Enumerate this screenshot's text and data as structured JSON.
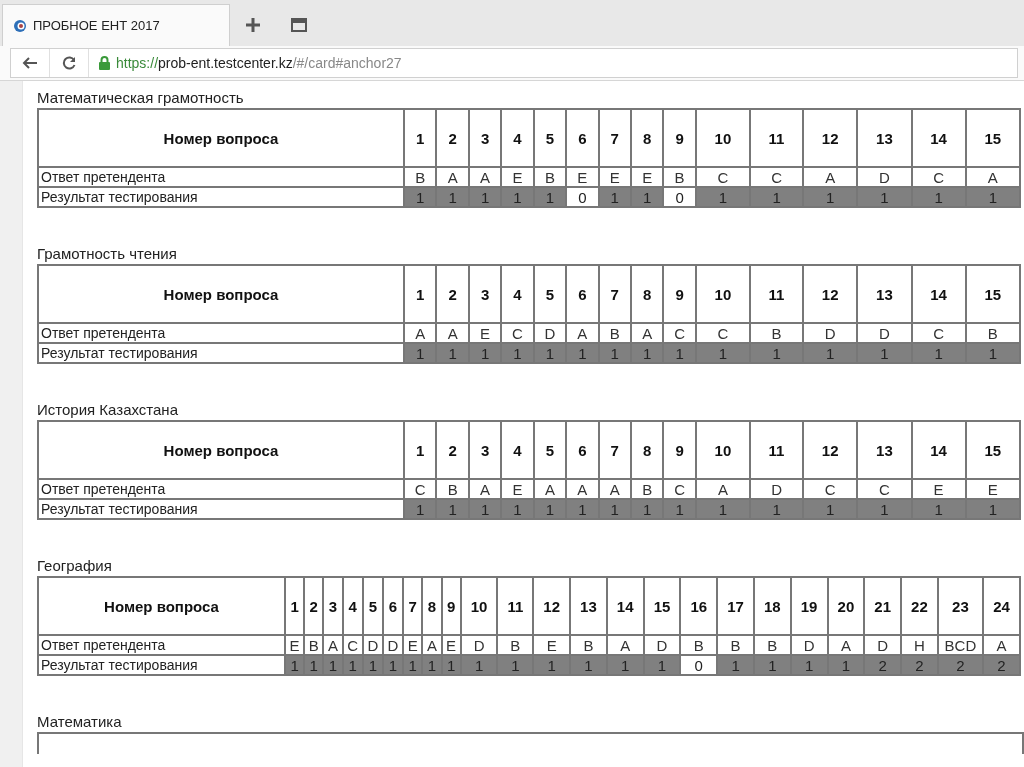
{
  "browser": {
    "tab": {
      "title": "ПРОБНОЕ ЕНТ 2017",
      "selected": true
    },
    "url": {
      "scheme": "https://",
      "host": "prob-ent.testcenter.kz",
      "path": "/#/card#anchor27"
    }
  },
  "sections": [
    {
      "title": "Математическая грамотность",
      "header_label": "Номер вопроса",
      "answer_label": "Ответ претендента",
      "result_label": "Результат тестирования",
      "questions": [
        "1",
        "2",
        "3",
        "4",
        "5",
        "6",
        "7",
        "8",
        "9",
        "10",
        "11",
        "12",
        "13",
        "14",
        "15"
      ],
      "answers": [
        "B",
        "A",
        "A",
        "E",
        "B",
        "E",
        "E",
        "E",
        "B",
        "C",
        "C",
        "A",
        "D",
        "C",
        "A"
      ],
      "results": [
        {
          "score": "1",
          "correct": true
        },
        {
          "score": "1",
          "correct": true
        },
        {
          "score": "1",
          "correct": true
        },
        {
          "score": "1",
          "correct": true
        },
        {
          "score": "1",
          "correct": true
        },
        {
          "score": "0",
          "correct": false
        },
        {
          "score": "1",
          "correct": true
        },
        {
          "score": "1",
          "correct": true
        },
        {
          "score": "0",
          "correct": false
        },
        {
          "score": "1",
          "correct": true
        },
        {
          "score": "1",
          "correct": true
        },
        {
          "score": "1",
          "correct": true
        },
        {
          "score": "1",
          "correct": true
        },
        {
          "score": "1",
          "correct": true
        },
        {
          "score": "1",
          "correct": true
        }
      ]
    },
    {
      "title": "Грамотность чтения",
      "header_label": "Номер вопроса",
      "answer_label": "Ответ претендента",
      "result_label": "Результат тестирования",
      "questions": [
        "1",
        "2",
        "3",
        "4",
        "5",
        "6",
        "7",
        "8",
        "9",
        "10",
        "11",
        "12",
        "13",
        "14",
        "15"
      ],
      "answers": [
        "A",
        "A",
        "E",
        "C",
        "D",
        "A",
        "B",
        "A",
        "C",
        "C",
        "B",
        "D",
        "D",
        "C",
        "B"
      ],
      "results": [
        {
          "score": "1",
          "correct": true
        },
        {
          "score": "1",
          "correct": true
        },
        {
          "score": "1",
          "correct": true
        },
        {
          "score": "1",
          "correct": true
        },
        {
          "score": "1",
          "correct": true
        },
        {
          "score": "1",
          "correct": true
        },
        {
          "score": "1",
          "correct": true
        },
        {
          "score": "1",
          "correct": true
        },
        {
          "score": "1",
          "correct": true
        },
        {
          "score": "1",
          "correct": true
        },
        {
          "score": "1",
          "correct": true
        },
        {
          "score": "1",
          "correct": true
        },
        {
          "score": "1",
          "correct": true
        },
        {
          "score": "1",
          "correct": true
        },
        {
          "score": "1",
          "correct": true
        }
      ]
    },
    {
      "title": "История Казахстана",
      "header_label": "Номер вопроса",
      "answer_label": "Ответ претендента",
      "result_label": "Результат тестирования",
      "questions": [
        "1",
        "2",
        "3",
        "4",
        "5",
        "6",
        "7",
        "8",
        "9",
        "10",
        "11",
        "12",
        "13",
        "14",
        "15"
      ],
      "answers": [
        "C",
        "B",
        "A",
        "E",
        "A",
        "A",
        "A",
        "B",
        "C",
        "A",
        "D",
        "C",
        "C",
        "E",
        "E"
      ],
      "results": [
        {
          "score": "1",
          "correct": true
        },
        {
          "score": "1",
          "correct": true
        },
        {
          "score": "1",
          "correct": true
        },
        {
          "score": "1",
          "correct": true
        },
        {
          "score": "1",
          "correct": true
        },
        {
          "score": "1",
          "correct": true
        },
        {
          "score": "1",
          "correct": true
        },
        {
          "score": "1",
          "correct": true
        },
        {
          "score": "1",
          "correct": true
        },
        {
          "score": "1",
          "correct": true
        },
        {
          "score": "1",
          "correct": true
        },
        {
          "score": "1",
          "correct": true
        },
        {
          "score": "1",
          "correct": true
        },
        {
          "score": "1",
          "correct": true
        },
        {
          "score": "1",
          "correct": true
        }
      ]
    },
    {
      "title": "География",
      "header_label": "Номер вопроса",
      "answer_label": "Ответ претендента",
      "result_label": "Результат тестирования",
      "questions": [
        "1",
        "2",
        "3",
        "4",
        "5",
        "6",
        "7",
        "8",
        "9",
        "10",
        "11",
        "12",
        "13",
        "14",
        "15",
        "16",
        "17",
        "18",
        "19",
        "20",
        "21",
        "22",
        "23",
        "24"
      ],
      "answers": [
        "E",
        "B",
        "A",
        "C",
        "D",
        "D",
        "E",
        "A",
        "E",
        "D",
        "B",
        "E",
        "B",
        "A",
        "D",
        "B",
        "B",
        "B",
        "D",
        "A",
        "D",
        "H",
        "BCD",
        "A"
      ],
      "results": [
        {
          "score": "1",
          "correct": true
        },
        {
          "score": "1",
          "correct": true
        },
        {
          "score": "1",
          "correct": true
        },
        {
          "score": "1",
          "correct": true
        },
        {
          "score": "1",
          "correct": true
        },
        {
          "score": "1",
          "correct": true
        },
        {
          "score": "1",
          "correct": true
        },
        {
          "score": "1",
          "correct": true
        },
        {
          "score": "1",
          "correct": true
        },
        {
          "score": "1",
          "correct": true
        },
        {
          "score": "1",
          "correct": true
        },
        {
          "score": "1",
          "correct": true
        },
        {
          "score": "1",
          "correct": true
        },
        {
          "score": "1",
          "correct": true
        },
        {
          "score": "1",
          "correct": true
        },
        {
          "score": "0",
          "correct": false
        },
        {
          "score": "1",
          "correct": true
        },
        {
          "score": "1",
          "correct": true
        },
        {
          "score": "1",
          "correct": true
        },
        {
          "score": "1",
          "correct": true
        },
        {
          "score": "2",
          "correct": true
        },
        {
          "score": "2",
          "correct": true
        },
        {
          "score": "2",
          "correct": true
        },
        {
          "score": "2",
          "correct": true
        }
      ]
    },
    {
      "title": "Математика"
    }
  ]
}
